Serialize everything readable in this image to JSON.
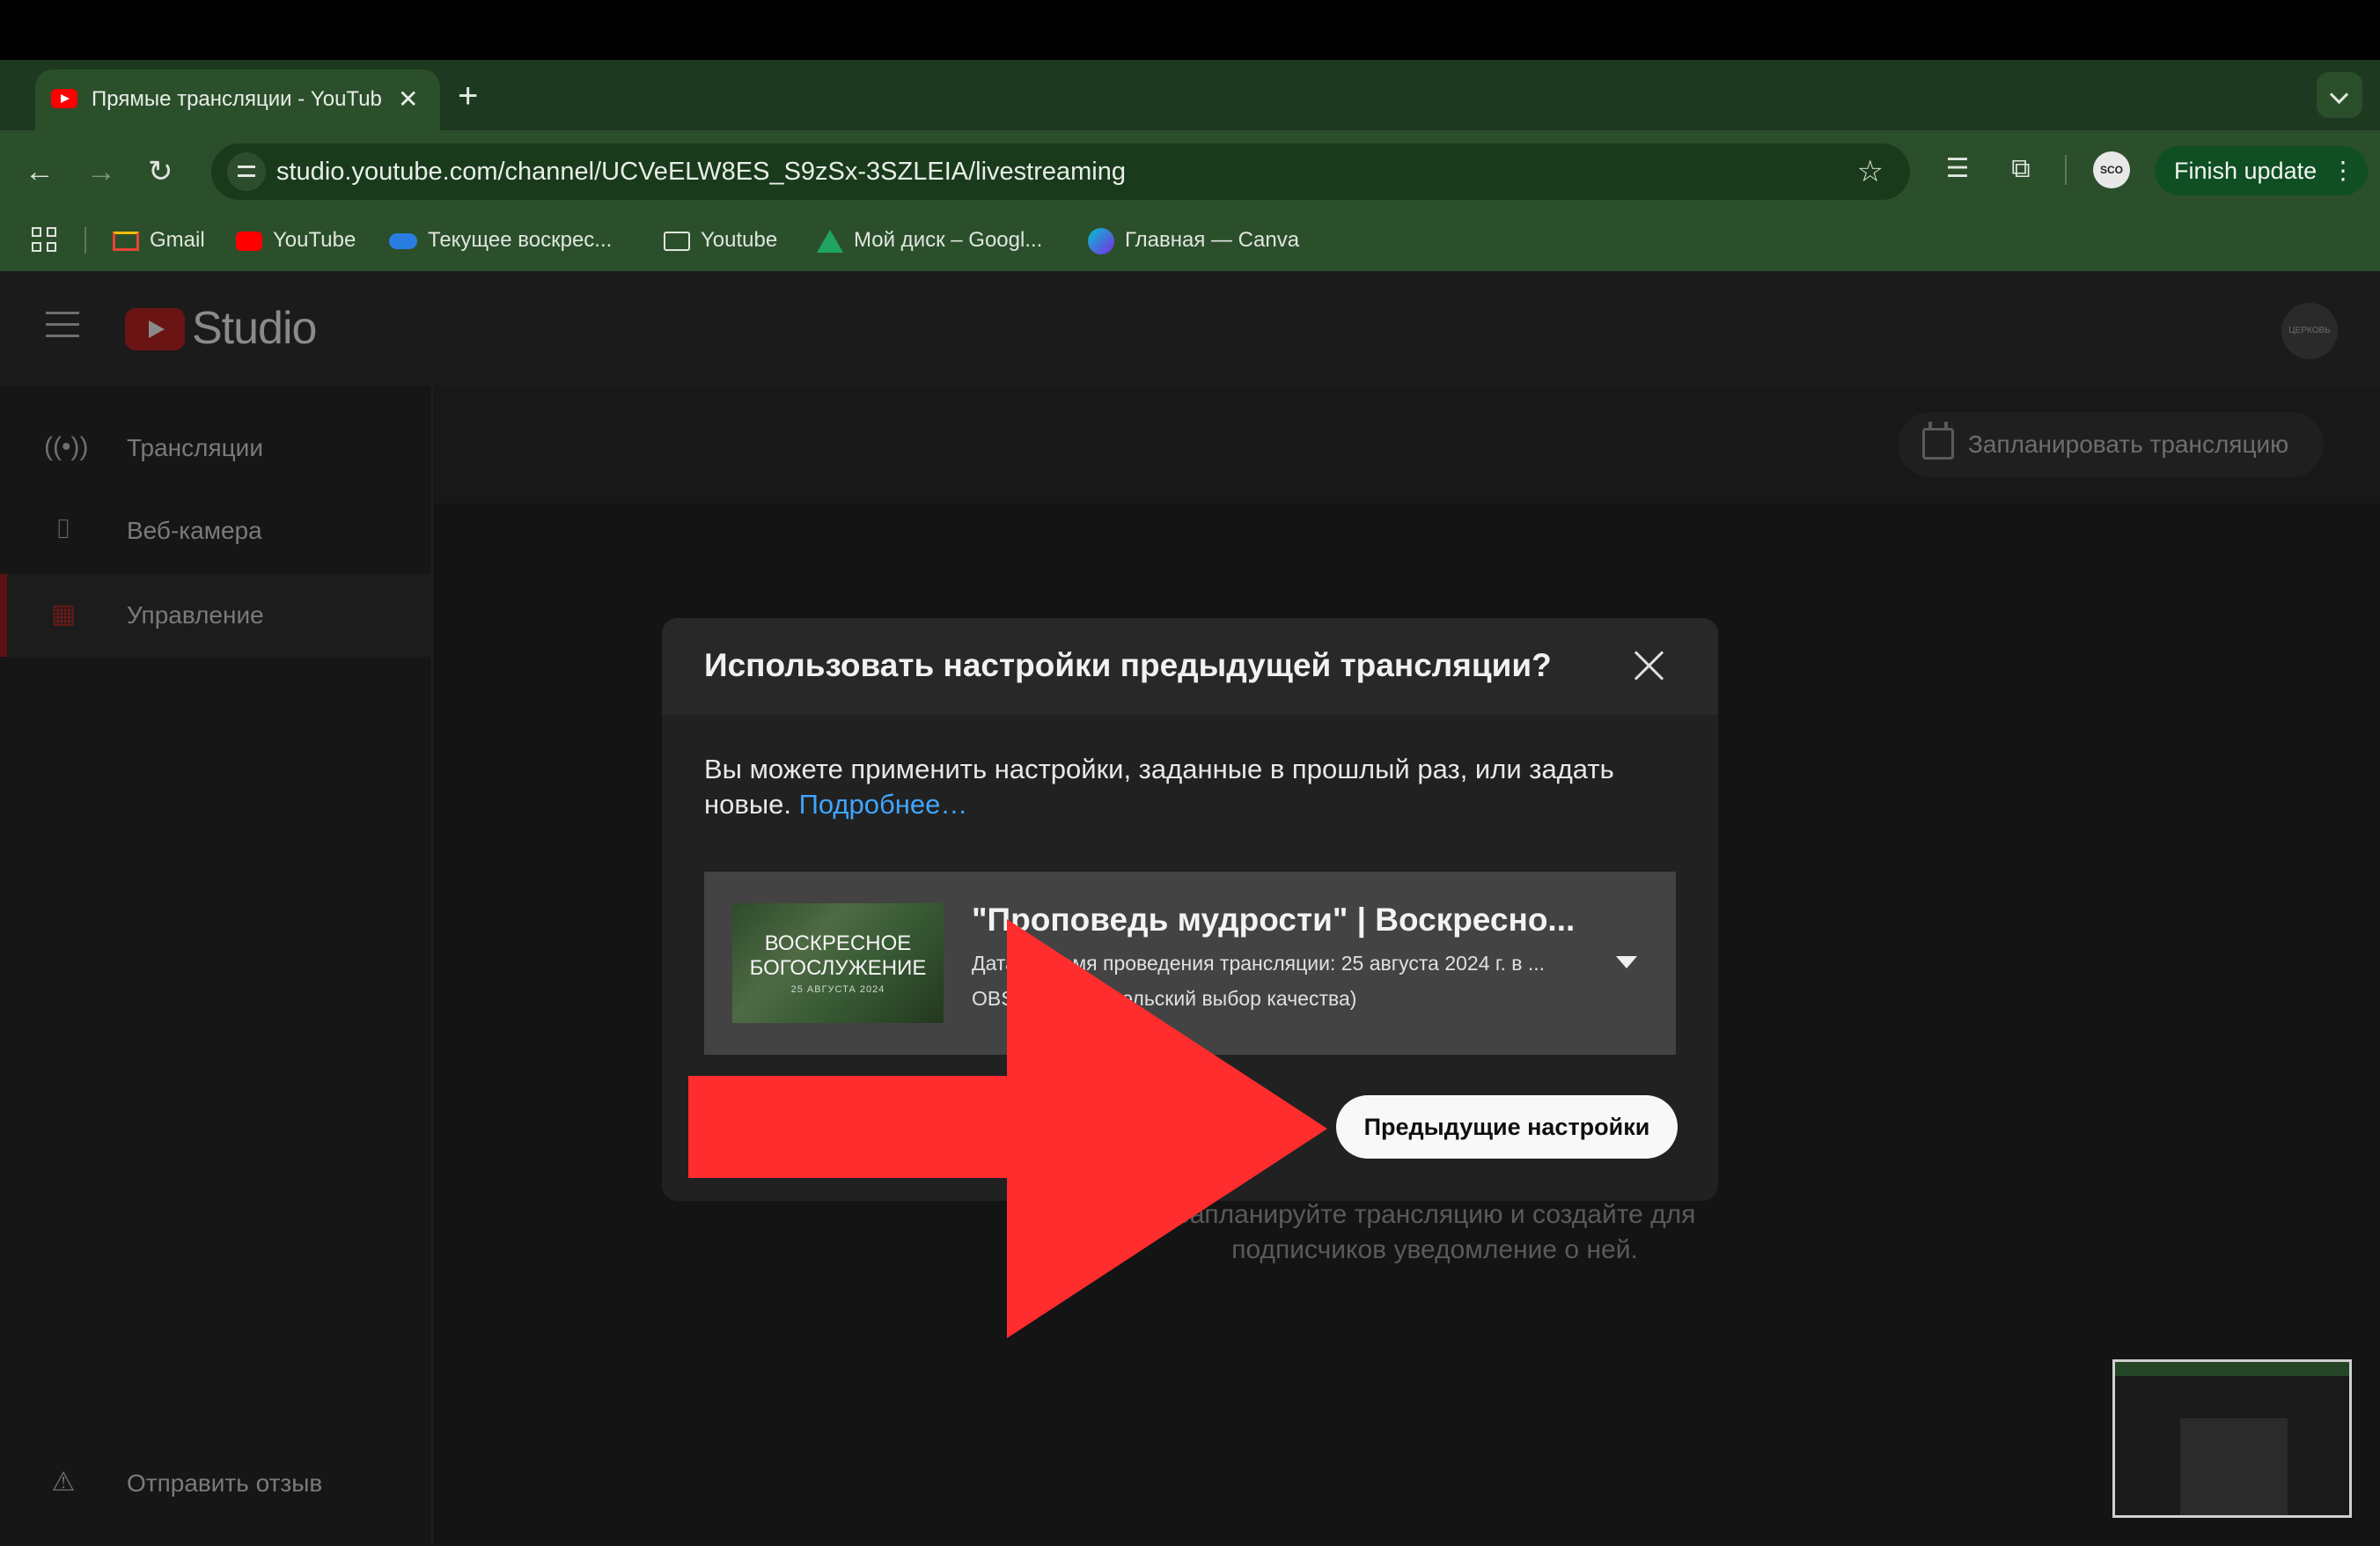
{
  "browser": {
    "tab_title": "Прямые трансляции - YouTube Studio",
    "tab_close": "✕",
    "new_tab": "+",
    "url": "studio.youtube.com/channel/UCVeELW8ES_S9zSx-3SZLEIA/livestreaming",
    "profile_badge": "SCO",
    "finish_update": "Finish update",
    "bookmarks": [
      {
        "label": "Gmail",
        "icon": "gmail-icon"
      },
      {
        "label": "YouTube",
        "icon": "youtube-icon"
      },
      {
        "label": "Текущее воскрес...",
        "icon": "onedrive-cloud-icon"
      },
      {
        "label": "Youtube",
        "icon": "folder-icon"
      },
      {
        "label": "Мой диск – Googl...",
        "icon": "google-drive-icon"
      },
      {
        "label": "Главная — Canva",
        "icon": "canva-icon"
      }
    ]
  },
  "studio": {
    "logo_text": "Studio",
    "avatar_text": "ЦЕРКОВЬ",
    "sidebar": [
      {
        "label": "Трансляции",
        "icon": "live-broadcast-icon"
      },
      {
        "label": "Веб-камера",
        "icon": "camera-icon"
      },
      {
        "label": "Управление",
        "icon": "calendar-icon"
      }
    ],
    "feedback": "Отправить отзыв",
    "schedule_button": "Запланировать трансляцию",
    "empty_text": "Запланируйте трансляцию и создайте для подписчиков уведомление о ней."
  },
  "dialog": {
    "title": "Использовать настройки предыдущей трансляции?",
    "description": "Вы можете применить настройки, заданные в прошлый раз, или задать новые.",
    "link": "Подробнее…",
    "card": {
      "title": "\"Проповедь мудрости\" | Воскресно...",
      "date_line": "Дата и время проведения трансляции: 25 августа 2024 г. в ...",
      "encoder_line": "OBS (пользовательский выбор качества)",
      "thumb_line1": "ВОСКРЕСНОЕ",
      "thumb_line2": "БОГОСЛУЖЕНИЕ",
      "thumb_line3": "25 АВГУСТА 2024"
    },
    "confirm_button": "Предыдущие настройки"
  },
  "colors": {
    "annotation_arrow": "#ff2d2d",
    "link": "#3ea6ff",
    "chrome_green": "#2b4f2b"
  }
}
